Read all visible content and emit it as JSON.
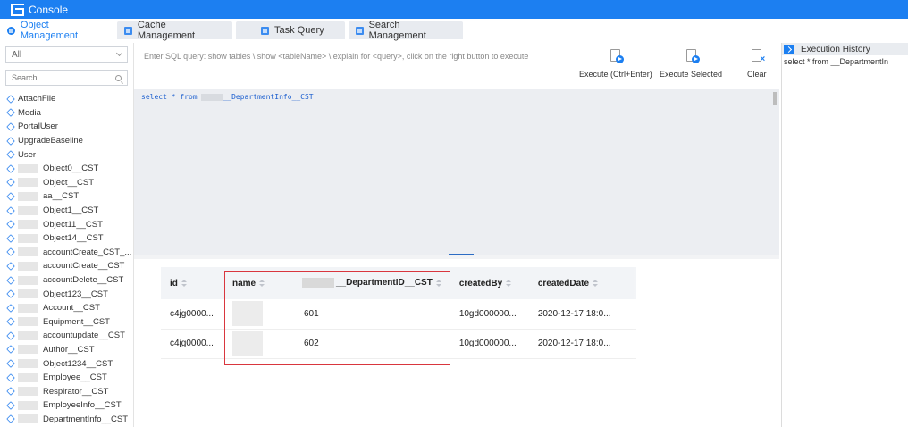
{
  "app": {
    "title": "Console"
  },
  "tabs": [
    {
      "label": "Object Management",
      "active": true
    },
    {
      "label": "Cache Management",
      "active": false
    },
    {
      "label": "Task Query",
      "active": false
    },
    {
      "label": "Search Management",
      "active": false
    }
  ],
  "sidebar": {
    "filter_value": "All",
    "search_placeholder": "Search",
    "items": [
      "AttachFile",
      "Media",
      "PortalUser",
      "UpgradeBaseline",
      "User",
      "Object0__CST",
      "Object__CST",
      "aa__CST",
      "Object1__CST",
      "Object11__CST",
      "Object14__CST",
      "accountCreate_CST_...",
      "accountCreate__CST",
      "accountDelete__CST",
      "Object123__CST",
      "Account__CST",
      "Equipment__CST",
      "accountupdate__CST",
      "Author__CST",
      "Object1234__CST",
      "Employee__CST",
      "Respirator__CST",
      "EmployeeInfo__CST",
      "DepartmentInfo__CST"
    ]
  },
  "query": {
    "hint": "Enter SQL query: show tables \\ show <tableName> \\ explain for <query>,  click on the right button to execute",
    "text": "select * from ___DepartmentInfo__CST",
    "text_prefix": "select * from",
    "text_suffix": "__DepartmentInfo__CST",
    "buttons": {
      "execute": "Execute (Ctrl+Enter)",
      "execute_selected": "Execute Selected",
      "clear": "Clear"
    }
  },
  "history": {
    "title": "Execution History",
    "entries": [
      "select * from      __DepartmentIn"
    ]
  },
  "results": {
    "columns": [
      "id",
      "name",
      "__DepartmentID__CST",
      "createdBy",
      "createdDate"
    ],
    "rows": [
      {
        "id": "c4jg0000...",
        "dept": "601",
        "createdBy": "10gd000000...",
        "createdDate": "2020-12-17 18:0..."
      },
      {
        "id": "c4jg0000...",
        "dept": "602",
        "createdBy": "10gd000000...",
        "createdDate": "2020-12-17 18:0..."
      }
    ]
  },
  "colors": {
    "accent": "#1c7ff1",
    "highlight_border": "#d9363e"
  }
}
